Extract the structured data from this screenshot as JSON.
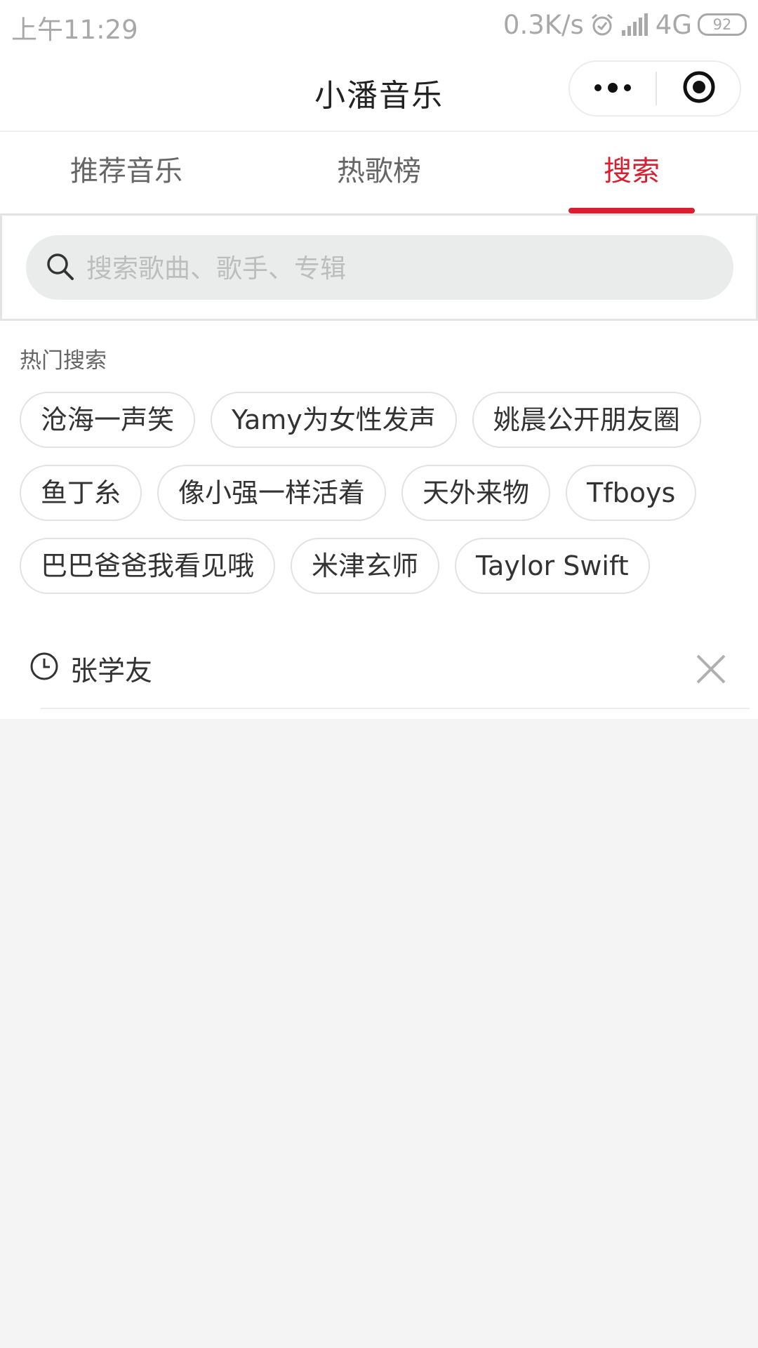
{
  "status_bar": {
    "time": "上午11:29",
    "network_speed": "0.3K/s",
    "network_type": "4G",
    "battery": "92",
    "icons": [
      "alarm-icon",
      "signal-icon"
    ]
  },
  "nav": {
    "title": "小潘音乐",
    "more_icon": "more-dots-icon",
    "close_icon": "target-circle-icon"
  },
  "tabs": [
    {
      "label": "推荐音乐",
      "active": false
    },
    {
      "label": "热歌榜",
      "active": false
    },
    {
      "label": "搜索",
      "active": true
    }
  ],
  "search": {
    "placeholder": "搜索歌曲、歌手、专辑",
    "value": ""
  },
  "hot_search": {
    "title": "热门搜索",
    "rows": [
      [
        "沧海一声笑",
        "Yamy为女性发声",
        "姚晨公开朋友圈"
      ],
      [
        "鱼丁糸",
        "像小强一样活着",
        "天外来物",
        "Tfboys"
      ],
      [
        "巴巴爸爸我看见哦",
        "米津玄师",
        "Taylor Swift"
      ]
    ]
  },
  "history": [
    {
      "text": "张学友",
      "icon": "clock-icon",
      "action_icon": "close-icon"
    }
  ],
  "colors": {
    "accent": "#d81e2f",
    "background": "#f4f4f4",
    "search_bg": "#eaecec"
  }
}
